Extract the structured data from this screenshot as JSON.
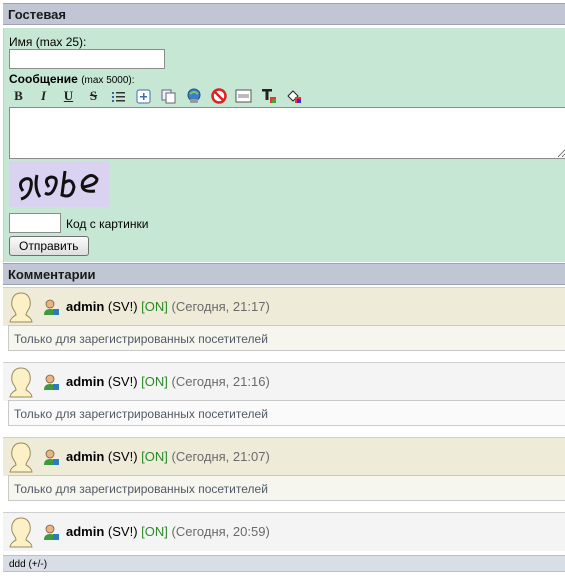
{
  "guestbook": {
    "title": "Гостевая",
    "name_label": "Имя (max 25):",
    "message_label": "Сообщение",
    "message_limit": "(max 5000):",
    "captcha_code_label": "Код с картинки",
    "submit_label": "Отправить",
    "toolbar": [
      "bold-icon",
      "italic-icon",
      "underline-icon",
      "strikethrough-icon",
      "list-icon",
      "add-icon",
      "copy-icon",
      "link-icon",
      "block-icon",
      "image-icon",
      "text-color-icon",
      "fill-color-icon"
    ],
    "toolbar_text": {
      "bold": "B",
      "italic": "I",
      "underline": "U",
      "strike": "S"
    }
  },
  "comments_section": {
    "title": "Комментарии",
    "items": [
      {
        "nick": "admin",
        "rank": "(SV!)",
        "status": "[ON]",
        "date": "(Сегодня, 21:17)",
        "text": "Только для зарегистрированных посетителей"
      },
      {
        "nick": "admin",
        "rank": "(SV!)",
        "status": "[ON]",
        "date": "(Сегодня, 21:16)",
        "text": "Только для зарегистрированных посетителей"
      },
      {
        "nick": "admin",
        "rank": "(SV!)",
        "status": "[ON]",
        "date": "(Сегодня, 21:07)",
        "text": "Только для зарегистрированных посетителей"
      },
      {
        "nick": "admin",
        "rank": "(SV!)",
        "status": "[ON]",
        "date": "(Сегодня, 20:59)"
      }
    ]
  },
  "footer_text": "ddd (+/-)",
  "colors": {
    "header_bg": "#c0c6d4",
    "form_bg": "#c7e7d5",
    "comment_tan": "#eeebd9",
    "status_green": "#2a8a2a"
  }
}
